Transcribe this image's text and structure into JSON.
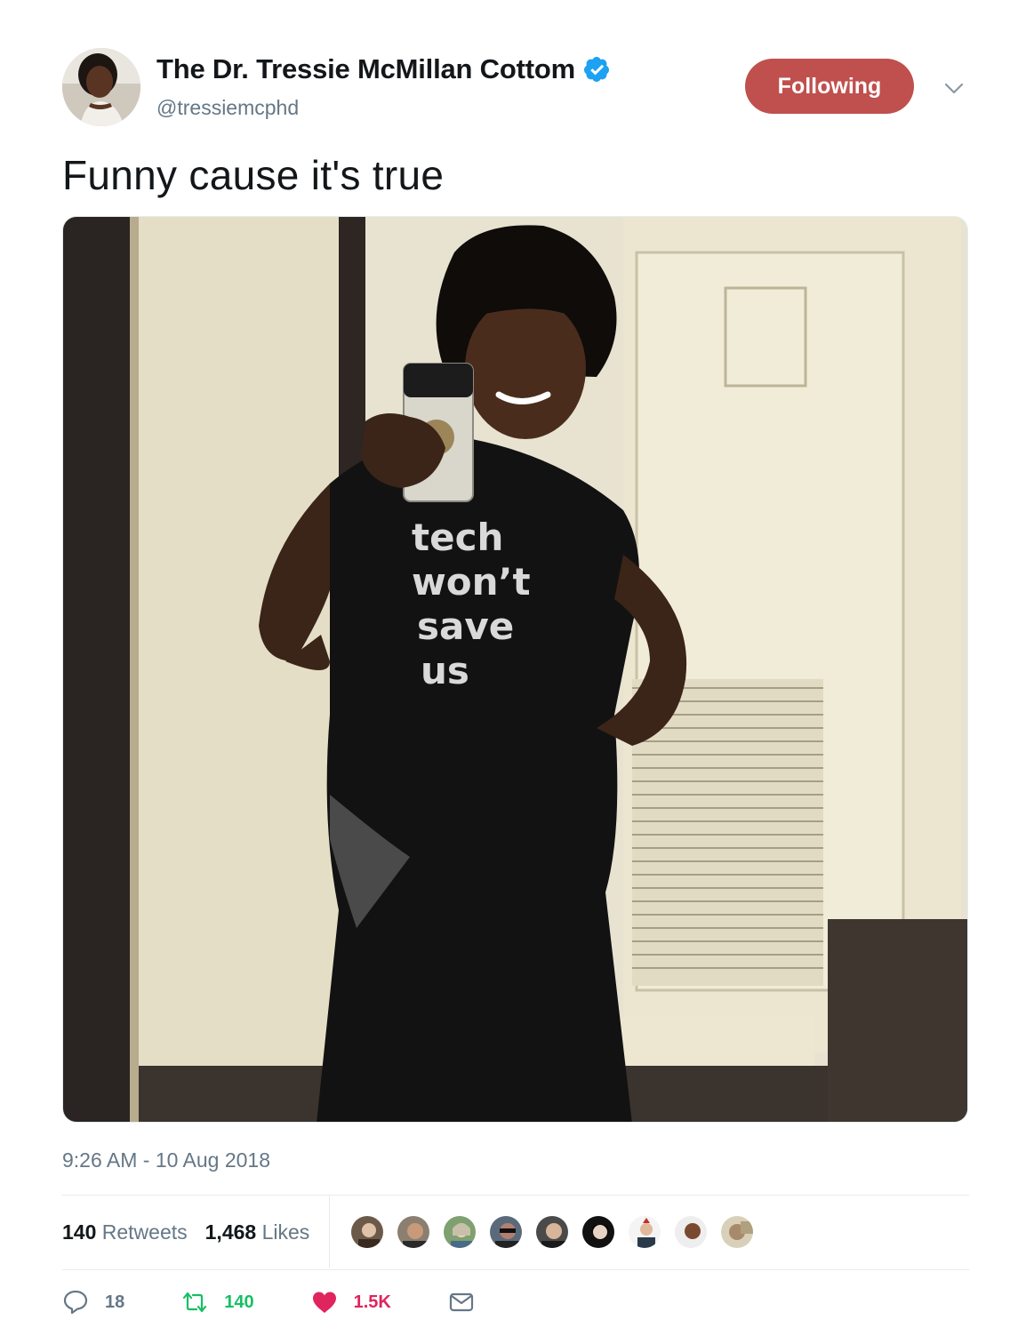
{
  "author": {
    "display_name": "The Dr. Tressie McMillan Cottom",
    "handle": "@tressiemcphd",
    "verified": true,
    "avatar_icon": "profile-photo"
  },
  "follow_button": {
    "label": "Following",
    "color": "#c0504d"
  },
  "menu_icon": "chevron-down-icon",
  "tweet": {
    "text": "Funny cause it's true",
    "media": {
      "type": "photo",
      "shirt_text": [
        "tech",
        "won’t",
        "save",
        "us"
      ]
    },
    "timestamp": "9:26 AM - 10 Aug 2018"
  },
  "stats": {
    "retweets_count": "140",
    "retweets_label": "Retweets",
    "likes_count": "1,468",
    "likes_label": "Likes",
    "liker_avatars": 9
  },
  "actions": {
    "reply": {
      "icon": "reply-icon",
      "count": "18"
    },
    "retweet": {
      "icon": "retweet-icon",
      "count": "140",
      "color": "#17bf63"
    },
    "like": {
      "icon": "heart-icon",
      "count": "1.5K",
      "color": "#e0245e"
    },
    "message": {
      "icon": "envelope-icon"
    }
  }
}
